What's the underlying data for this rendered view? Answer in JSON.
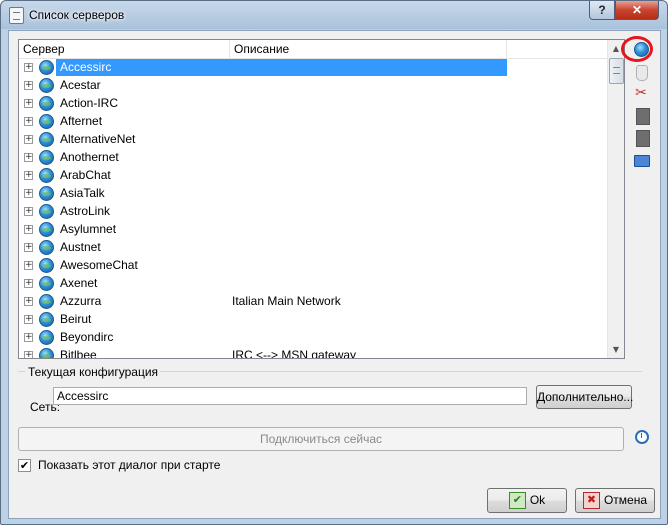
{
  "window": {
    "title": "Список серверов",
    "help_glyph": "?",
    "close_glyph": "✕"
  },
  "list": {
    "columns": [
      "Сервер",
      "Описание"
    ],
    "rows": [
      {
        "name": "Accessirc",
        "desc": "",
        "selected": true
      },
      {
        "name": "Acestar",
        "desc": ""
      },
      {
        "name": "Action-IRC",
        "desc": ""
      },
      {
        "name": "Afternet",
        "desc": ""
      },
      {
        "name": "AlternativeNet",
        "desc": ""
      },
      {
        "name": "Anothernet",
        "desc": ""
      },
      {
        "name": "ArabChat",
        "desc": ""
      },
      {
        "name": "AsiaTalk",
        "desc": ""
      },
      {
        "name": "AstroLink",
        "desc": ""
      },
      {
        "name": "Asylumnet",
        "desc": ""
      },
      {
        "name": "Austnet",
        "desc": ""
      },
      {
        "name": "AwesomeChat",
        "desc": ""
      },
      {
        "name": "Axenet",
        "desc": ""
      },
      {
        "name": "Azzurra",
        "desc": "Italian Main Network"
      },
      {
        "name": "Beirut",
        "desc": ""
      },
      {
        "name": "Beyondirc",
        "desc": ""
      },
      {
        "name": "Bitlbee",
        "desc": "IRC <--> MSN gateway"
      }
    ],
    "expander_glyph": "+"
  },
  "toolbar_icons": [
    "globe-icon",
    "hand-icon",
    "scissors-icon",
    "copy-icon",
    "paste-icon",
    "folder-open-icon"
  ],
  "config": {
    "group_title": "Текущая конфигурация",
    "network_label": "Сеть:",
    "network_value": "Accessirc",
    "advanced_button": "Дополнительно..."
  },
  "connect_button": "Подключиться сейчас",
  "show_dialog_label": "Показать этот диалог при старте",
  "show_dialog_checked": true,
  "ok_button": "Ok",
  "cancel_button": "Отмена",
  "colors": {
    "selection": "#3399ff",
    "highlight_circle": "#e8141e"
  }
}
